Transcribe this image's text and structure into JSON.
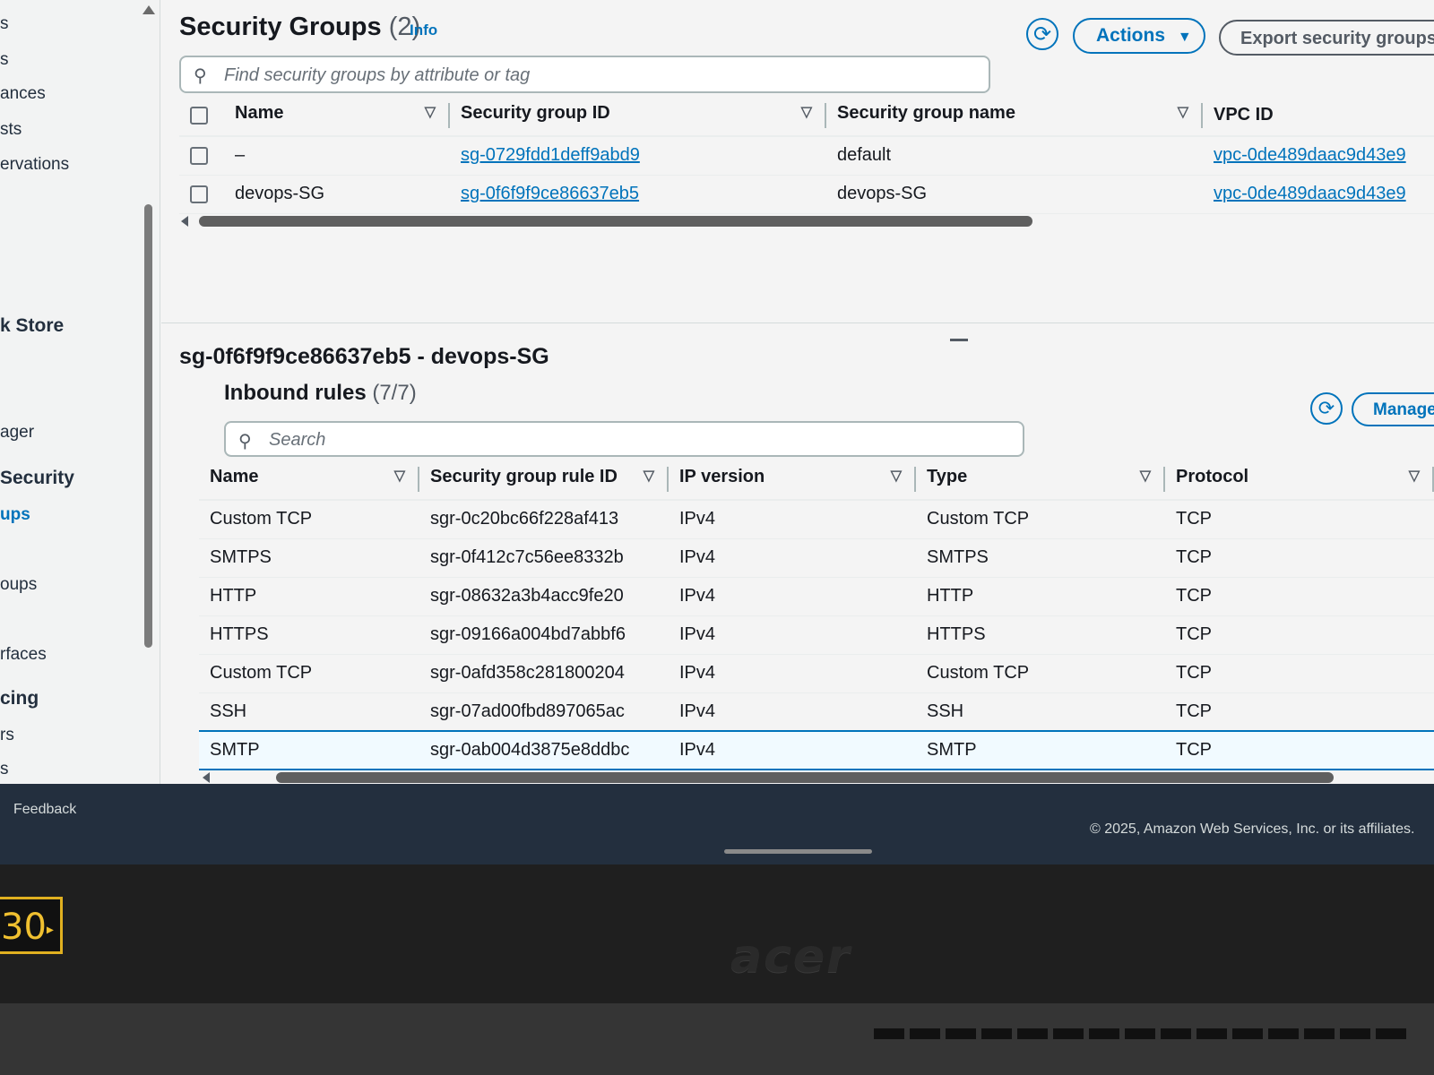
{
  "sidebar": {
    "items": [
      {
        "label": "s"
      },
      {
        "label": "s"
      },
      {
        "label": "ances"
      },
      {
        "label": "sts"
      },
      {
        "label": "ervations"
      },
      {
        "label": "k Store"
      },
      {
        "label": "ager"
      },
      {
        "label": "Security"
      },
      {
        "label": "ups"
      },
      {
        "label": "oups"
      },
      {
        "label": "rfaces"
      },
      {
        "label": "cing"
      },
      {
        "label": "rs"
      },
      {
        "label": "s"
      }
    ]
  },
  "header": {
    "title": "Security Groups",
    "count": "(2)",
    "info": "Info",
    "refresh_icon": "refresh-icon",
    "actions_label": "Actions",
    "export_label": "Export security groups",
    "search_placeholder": "Find security groups by attribute or tag"
  },
  "sg_table": {
    "columns": [
      "Name",
      "Security group ID",
      "Security group name",
      "VPC ID"
    ],
    "rows": [
      {
        "name": "–",
        "id": "sg-0729fdd1deff9abd9",
        "sg_name": "default",
        "vpc": "vpc-0de489daac9d43e9"
      },
      {
        "name": "devops-SG",
        "id": "sg-0f6f9f9ce86637eb5",
        "sg_name": "devops-SG",
        "vpc": "vpc-0de489daac9d43e9"
      }
    ]
  },
  "detail": {
    "title": "sg-0f6f9f9ce86637eb5 - devops-SG",
    "inbound_title": "Inbound rules",
    "inbound_count": "(7/7)",
    "search_placeholder": "Search",
    "manage_label": "Manage"
  },
  "rules_table": {
    "columns": [
      "Name",
      "Security group rule ID",
      "IP version",
      "Type",
      "Protocol"
    ],
    "rows": [
      {
        "name": "Custom TCP",
        "rule_id": "sgr-0c20bc66f228af413",
        "ip": "IPv4",
        "type": "Custom TCP",
        "protocol": "TCP"
      },
      {
        "name": "SMTPS",
        "rule_id": "sgr-0f412c7c56ee8332b",
        "ip": "IPv4",
        "type": "SMTPS",
        "protocol": "TCP"
      },
      {
        "name": "HTTP",
        "rule_id": "sgr-08632a3b4acc9fe20",
        "ip": "IPv4",
        "type": "HTTP",
        "protocol": "TCP"
      },
      {
        "name": "HTTPS",
        "rule_id": "sgr-09166a004bd7abbf6",
        "ip": "IPv4",
        "type": "HTTPS",
        "protocol": "TCP"
      },
      {
        "name": "Custom TCP",
        "rule_id": "sgr-0afd358c281800204",
        "ip": "IPv4",
        "type": "Custom TCP",
        "protocol": "TCP"
      },
      {
        "name": "SSH",
        "rule_id": "sgr-07ad00fbd897065ac",
        "ip": "IPv4",
        "type": "SSH",
        "protocol": "TCP"
      },
      {
        "name": "SMTP",
        "rule_id": "sgr-0ab004d3875e8ddbc",
        "ip": "IPv4",
        "type": "SMTP",
        "protocol": "TCP"
      }
    ],
    "selected_index": 6
  },
  "footer": {
    "feedback": "Feedback",
    "copyright": "© 2025, Amazon Web Services, Inc. or its affiliates."
  },
  "hardware": {
    "brand": "acer",
    "sticker": "30"
  },
  "colors": {
    "link": "#0073bb",
    "footer_bg": "#232f3e"
  }
}
